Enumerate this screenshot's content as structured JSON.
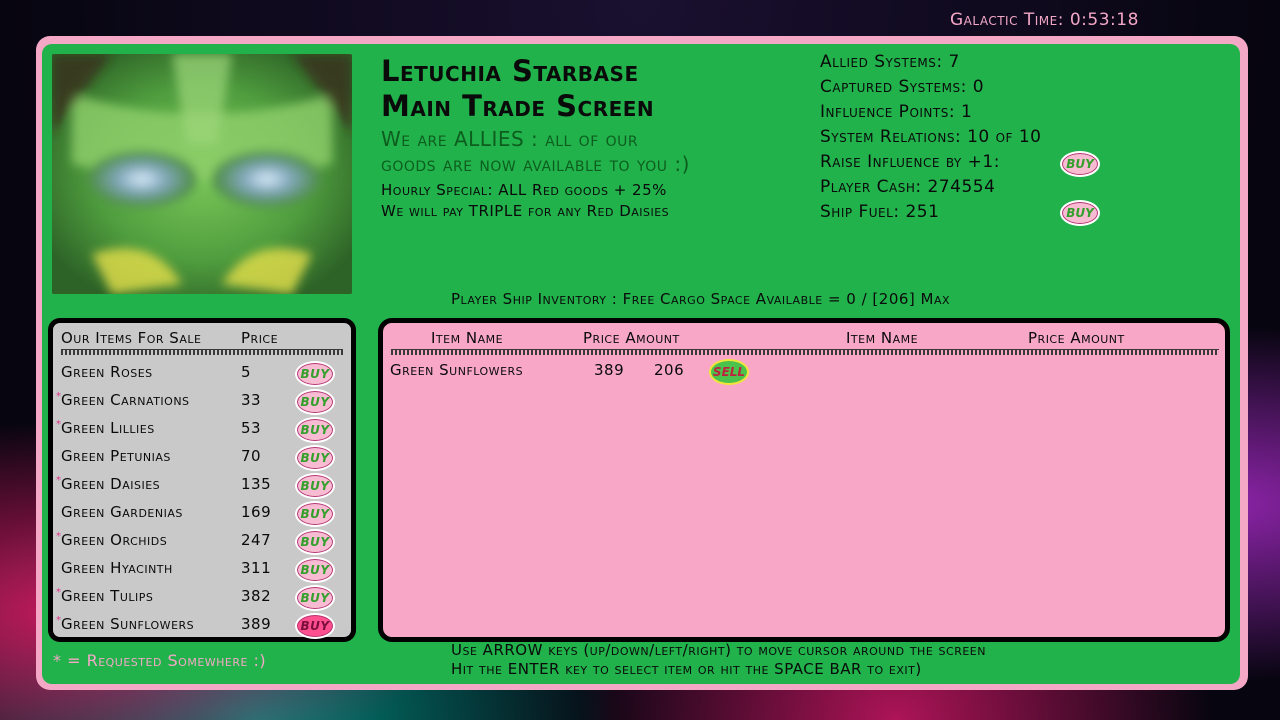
{
  "galactic_time": "Galactic Time: 0:53:18",
  "header": {
    "title_line1": "Letuchia Starbase",
    "title_line2": "Main Trade Screen",
    "allies_line1": "We are ALLIES : all of our",
    "allies_line2": "goods are now available to you :)",
    "special_line1": "Hourly Special: ALL Red goods + 25%",
    "special_line2": "We will pay TRIPLE for any Red Daisies"
  },
  "stats": {
    "allied_systems": "Allied Systems: 7",
    "captured_systems": "Captured Systems: 0",
    "influence_points": "Influence Points: 1",
    "system_relations": "System Relations: 10 of 10",
    "raise_influence": "Raise Influence by +1:",
    "player_cash": "Player Cash: 274554",
    "ship_fuel": "Ship Fuel: 251"
  },
  "buttons": {
    "buy": "BUY",
    "sell": "SELL"
  },
  "inventory_header": "Player Ship Inventory   :   Free Cargo Space Available = 0   /   [206] Max",
  "shop": {
    "col_item": "Our Items For Sale",
    "col_price": "Price",
    "items": [
      {
        "name": "Green Roses",
        "price": "5",
        "requested": false
      },
      {
        "name": "Green Carnations",
        "price": "33",
        "requested": true
      },
      {
        "name": "Green Lillies",
        "price": "53",
        "requested": true
      },
      {
        "name": "Green Petunias",
        "price": "70",
        "requested": false
      },
      {
        "name": "Green Daisies",
        "price": "135",
        "requested": true
      },
      {
        "name": "Green Gardenias",
        "price": "169",
        "requested": false
      },
      {
        "name": "Green Orchids",
        "price": "247",
        "requested": true
      },
      {
        "name": "Green Hyacinth",
        "price": "311",
        "requested": false
      },
      {
        "name": "Green Tulips",
        "price": "382",
        "requested": true
      },
      {
        "name": "Green Sunflowers",
        "price": "389",
        "requested": true
      }
    ],
    "selected_index": 9
  },
  "inventory": {
    "col_item_name": "Item Name",
    "col_price_amount": "Price Amount",
    "col_item_name_2": "Item Name",
    "col_price_amount_2": "Price Amount",
    "rows": [
      {
        "name": "Green Sunflowers",
        "price": "389",
        "amount": "206"
      }
    ]
  },
  "requested_note": "* = Requested Somewhere :)",
  "instructions": {
    "line1": "Use ARROW keys (up/down/left/right) to move cursor around the screen",
    "line2": "Hit the ENTER key to select item or hit the SPACE BAR to exit)"
  },
  "colors": {
    "panel_green": "#21b24b",
    "frame_pink": "#f4a8c6",
    "shop_gray": "#c9c9c9",
    "selected_buy": "#ff4f8e",
    "sell_button": "#4ac24c"
  },
  "icons": {
    "portrait": "alien-portrait"
  }
}
